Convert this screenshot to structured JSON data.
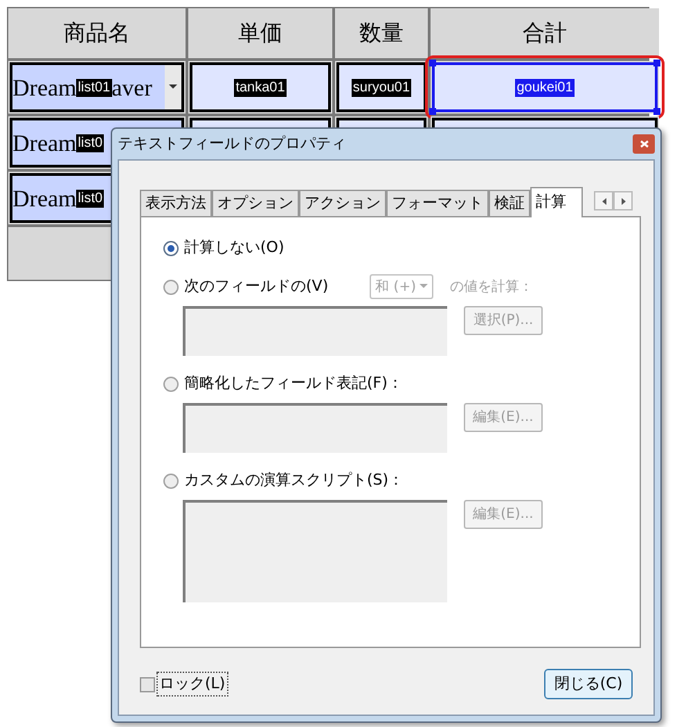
{
  "table": {
    "columns": [
      "商品名",
      "単価",
      "数量",
      "合計"
    ],
    "rows": [
      {
        "product": {
          "text_start": "Dream",
          "name_tag": "list01",
          "text_end": "aver",
          "dropdown": true
        },
        "price_tag": "tanka01",
        "qty_tag": "suryou01",
        "total_tag": "goukei01",
        "selected": true
      },
      {
        "product": {
          "text_start": "Dream",
          "name_tag": "list0"
        },
        "selected": false
      },
      {
        "product": {
          "text_start": "Dream",
          "name_tag": "list0"
        },
        "selected": false
      }
    ]
  },
  "dialog": {
    "title": "テキストフィールドのプロパティ",
    "tabs": [
      {
        "label": "表示方法",
        "selected": false
      },
      {
        "label": "オプション",
        "selected": false
      },
      {
        "label": "アクション",
        "selected": false
      },
      {
        "label": "フォーマット",
        "selected": false
      },
      {
        "label": "検証",
        "selected": false
      },
      {
        "label": "計算",
        "selected": true
      }
    ],
    "options": [
      {
        "kind": "plain",
        "label": "計算しない(O)",
        "selected": true
      },
      {
        "kind": "fields",
        "label": "次のフィールドの(V)",
        "operator": "和 (+)",
        "suffix": "の値を計算：",
        "button": "選択(P)...",
        "selected": false
      },
      {
        "kind": "edit",
        "label": "簡略化したフィールド表記(F)：",
        "button": "編集(E)...",
        "selected": false
      },
      {
        "kind": "script",
        "label": "カスタムの演算スクリプト(S)：",
        "button": "編集(E)...",
        "selected": false
      }
    ],
    "lock": {
      "label": "ロック(L)",
      "checked": false
    },
    "close_button": "閉じる(C)"
  }
}
